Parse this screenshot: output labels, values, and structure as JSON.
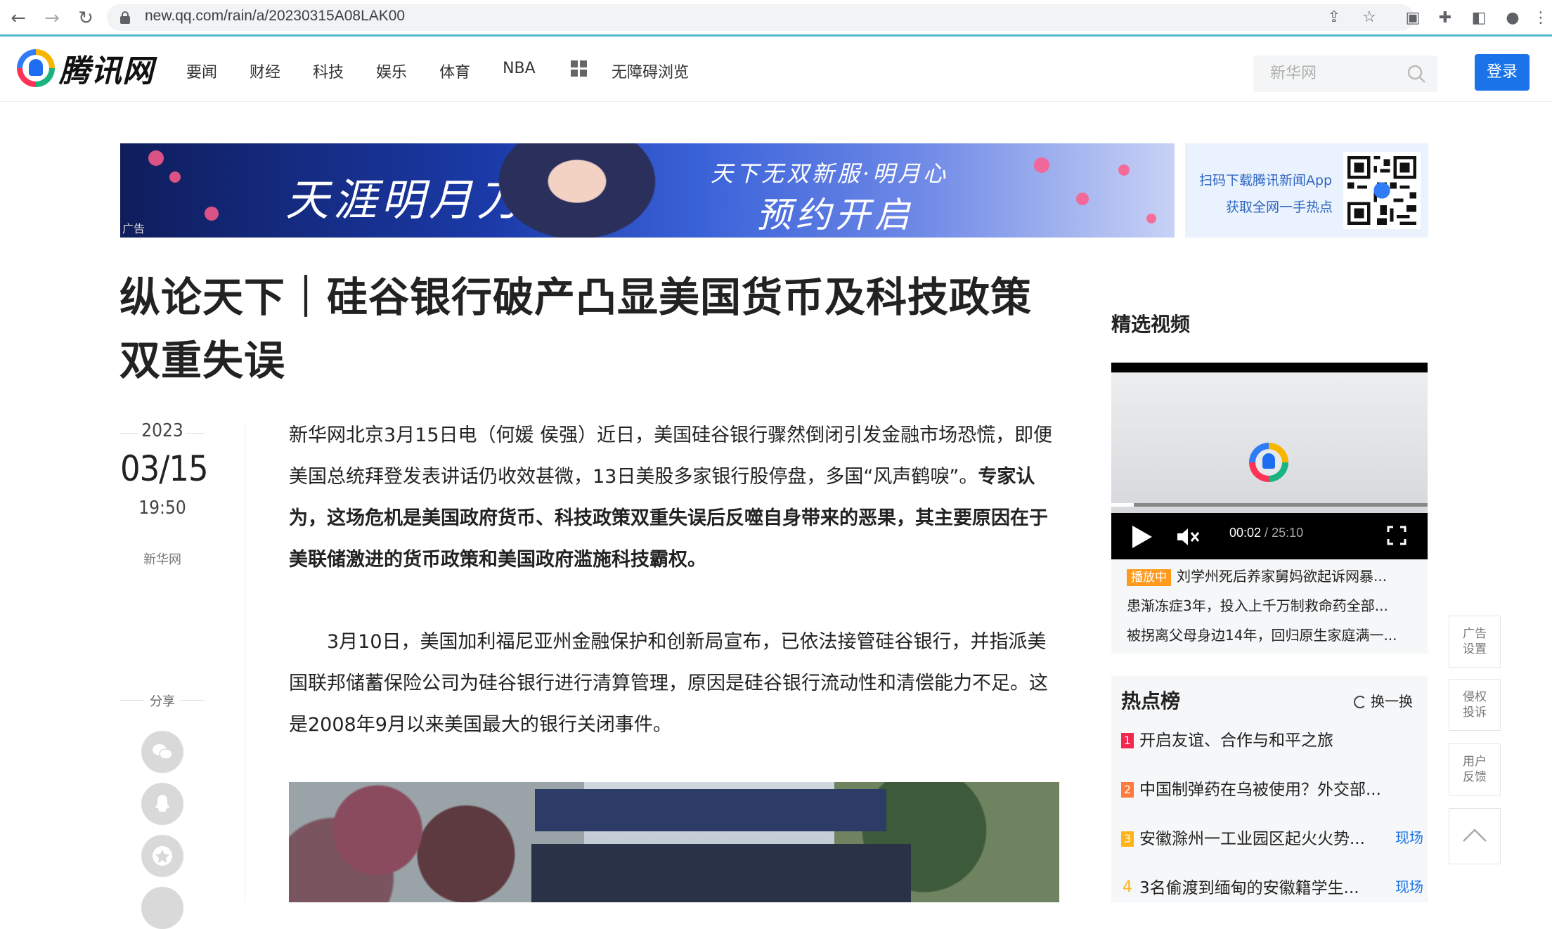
{
  "browser": {
    "url": "new.qq.com/rain/a/20230315A08LAK00"
  },
  "header": {
    "logo_text": "腾讯网",
    "nav": [
      "要闻",
      "财经",
      "科技",
      "娱乐",
      "体育",
      "NBA"
    ],
    "accessibility": "无障碍浏览",
    "search_placeholder": "新华网",
    "login": "登录"
  },
  "banner": {
    "game_title": "天涯明月刀",
    "slogan_line1": "天下无双新服·明月心",
    "slogan_line2": "预约开启",
    "ad_tag": "广告",
    "app_line1": "扫码下载腾讯新闻App",
    "app_line2": "获取全网一手热点"
  },
  "article": {
    "title": "纵论天下｜硅谷银行破产凸显美国货币及科技政策双重失误",
    "date_year": "2023",
    "date_md": "03/15",
    "date_time": "19:50",
    "source": "新华网",
    "share_label": "分享",
    "p1_normal": "新华网北京3月15日电（何媛 侯强）近日，美国硅谷银行骤然倒闭引发金融市场恐慌，即便美国总统拜登发表讲话仍收效甚微，13日美股多家银行股停盘，多国“风声鹤唳”。",
    "p1_bold": "专家认为，这场危机是美国政府货币、科技政策双重失误后反噬自身带来的恶果，其主要原因在于美联储激进的货币政策和美国政府滥施科技霸权。",
    "p2": "3月10日，美国加利福尼亚州金融保护和创新局宣布，已依法接管硅谷银行，并指派美国联邦储蓄保险公司为硅谷银行进行清算管理，原因是硅谷银行流动性和清偿能力不足。这是2008年9月以来美国最大的银行关闭事件。"
  },
  "sidebar": {
    "video_section_title": "精选视频",
    "video_current": "00:02",
    "video_duration": "25:10",
    "video_progress": 0.0013,
    "playing_tag": "播放中",
    "videos": [
      "刘学州死后养家舅妈欲起诉网暴...",
      "患渐冻症3年，投入上千万制救命药全部...",
      "被拐离父母身边14年，回归原生家庭满一..."
    ],
    "hot_title": "热点榜",
    "refresh": "换一换",
    "hot_items": [
      {
        "rank": "1",
        "text": "开启友谊、合作与和平之旅",
        "tag": "",
        "color": "#f5274d"
      },
      {
        "rank": "2",
        "text": "中国制弹药在乌被使用？外交部...",
        "tag": "",
        "color": "#ff7a3d"
      },
      {
        "rank": "3",
        "text": "安徽滁州一工业园区起火火势...",
        "tag": "现场",
        "color": "#ffb31a"
      },
      {
        "rank": "4",
        "text": "3名偷渡到缅甸的安徽籍学生...",
        "tag": "现场",
        "color": "#ffb31a"
      }
    ]
  },
  "float_buttons": [
    "广告设置",
    "侵权投诉",
    "用户反馈"
  ]
}
